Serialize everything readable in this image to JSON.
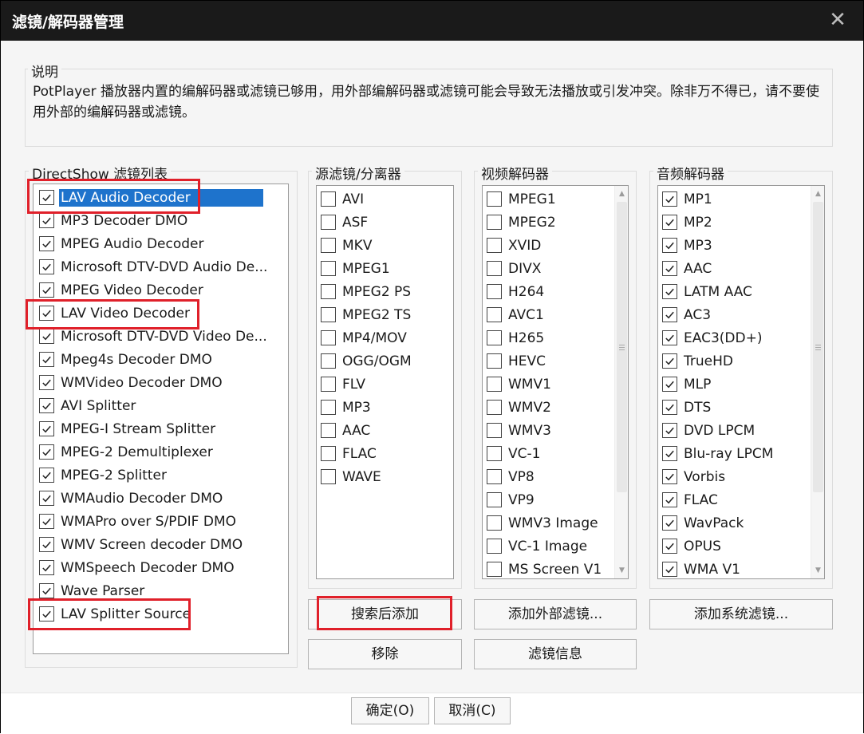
{
  "window": {
    "title": "滤镜/解码器管理",
    "close_glyph": "✕"
  },
  "description": {
    "label": "说明",
    "text": "PotPlayer 播放器内置的编解码器或滤镜已够用，用外部编解码器或滤镜可能会导致无法播放或引发冲突。除非万不得已，请不要使用外部的编解码器或滤镜。"
  },
  "directshow": {
    "label": "DirectShow 滤镜列表",
    "items": [
      {
        "label": "LAV Audio Decoder",
        "checked": true,
        "selected": true
      },
      {
        "label": "MP3 Decoder DMO",
        "checked": true
      },
      {
        "label": "MPEG Audio Decoder",
        "checked": true
      },
      {
        "label": "Microsoft DTV-DVD Audio De...",
        "checked": true
      },
      {
        "label": "MPEG Video Decoder",
        "checked": true
      },
      {
        "label": "LAV Video Decoder",
        "checked": true
      },
      {
        "label": "Microsoft DTV-DVD Video De...",
        "checked": true
      },
      {
        "label": "Mpeg4s Decoder DMO",
        "checked": true
      },
      {
        "label": "WMVideo Decoder DMO",
        "checked": true
      },
      {
        "label": "AVI Splitter",
        "checked": true
      },
      {
        "label": "MPEG-I Stream Splitter",
        "checked": true
      },
      {
        "label": "MPEG-2 Demultiplexer",
        "checked": true
      },
      {
        "label": "MPEG-2 Splitter",
        "checked": true
      },
      {
        "label": "WMAudio Decoder DMO",
        "checked": true
      },
      {
        "label": "WMAPro over S/PDIF DMO",
        "checked": true
      },
      {
        "label": "WMV Screen decoder DMO",
        "checked": true
      },
      {
        "label": "WMSpeech Decoder DMO",
        "checked": true
      },
      {
        "label": "Wave Parser",
        "checked": true
      },
      {
        "label": "LAV Splitter Source",
        "checked": true
      }
    ]
  },
  "source_filters": {
    "label": "源滤镜/分离器",
    "items": [
      {
        "label": "AVI",
        "checked": false
      },
      {
        "label": "ASF",
        "checked": false
      },
      {
        "label": "MKV",
        "checked": false
      },
      {
        "label": "MPEG1",
        "checked": false
      },
      {
        "label": "MPEG2 PS",
        "checked": false
      },
      {
        "label": "MPEG2 TS",
        "checked": false
      },
      {
        "label": "MP4/MOV",
        "checked": false
      },
      {
        "label": "OGG/OGM",
        "checked": false
      },
      {
        "label": "FLV",
        "checked": false
      },
      {
        "label": "MP3",
        "checked": false
      },
      {
        "label": "AAC",
        "checked": false
      },
      {
        "label": "FLAC",
        "checked": false
      },
      {
        "label": "WAVE",
        "checked": false
      }
    ]
  },
  "video_decoders": {
    "label": "视频解码器",
    "items": [
      {
        "label": "MPEG1",
        "checked": false
      },
      {
        "label": "MPEG2",
        "checked": false
      },
      {
        "label": "XVID",
        "checked": false
      },
      {
        "label": "DIVX",
        "checked": false
      },
      {
        "label": "H264",
        "checked": false
      },
      {
        "label": "AVC1",
        "checked": false
      },
      {
        "label": "H265",
        "checked": false
      },
      {
        "label": "HEVC",
        "checked": false
      },
      {
        "label": "WMV1",
        "checked": false
      },
      {
        "label": "WMV2",
        "checked": false
      },
      {
        "label": "WMV3",
        "checked": false
      },
      {
        "label": "VC-1",
        "checked": false
      },
      {
        "label": "VP8",
        "checked": false
      },
      {
        "label": "VP9",
        "checked": false
      },
      {
        "label": "WMV3 Image",
        "checked": false
      },
      {
        "label": "VC-1 Image",
        "checked": false
      },
      {
        "label": "MS Screen V1",
        "checked": false
      }
    ]
  },
  "audio_decoders": {
    "label": "音频解码器",
    "items": [
      {
        "label": "MP1",
        "checked": true
      },
      {
        "label": "MP2",
        "checked": true
      },
      {
        "label": "MP3",
        "checked": true
      },
      {
        "label": "AAC",
        "checked": true
      },
      {
        "label": "LATM AAC",
        "checked": true
      },
      {
        "label": "AC3",
        "checked": true
      },
      {
        "label": "EAC3(DD+)",
        "checked": true
      },
      {
        "label": "TrueHD",
        "checked": true
      },
      {
        "label": "MLP",
        "checked": true
      },
      {
        "label": "DTS",
        "checked": true
      },
      {
        "label": "DVD LPCM",
        "checked": true
      },
      {
        "label": "Blu-ray LPCM",
        "checked": true
      },
      {
        "label": "Vorbis",
        "checked": true
      },
      {
        "label": "FLAC",
        "checked": true
      },
      {
        "label": "WavPack",
        "checked": true
      },
      {
        "label": "OPUS",
        "checked": true
      },
      {
        "label": "WMA V1",
        "checked": true
      }
    ]
  },
  "buttons": {
    "search_add": "搜索后添加",
    "add_external": "添加外部滤镜...",
    "add_system": "添加系统滤镜...",
    "remove": "移除",
    "filter_info": "滤镜信息",
    "ok": "确定(O)",
    "cancel": "取消(C)"
  },
  "colors": {
    "selection": "#1e73cc",
    "highlight_box": "#e0202a",
    "titlebar": "#1a1a1a"
  }
}
